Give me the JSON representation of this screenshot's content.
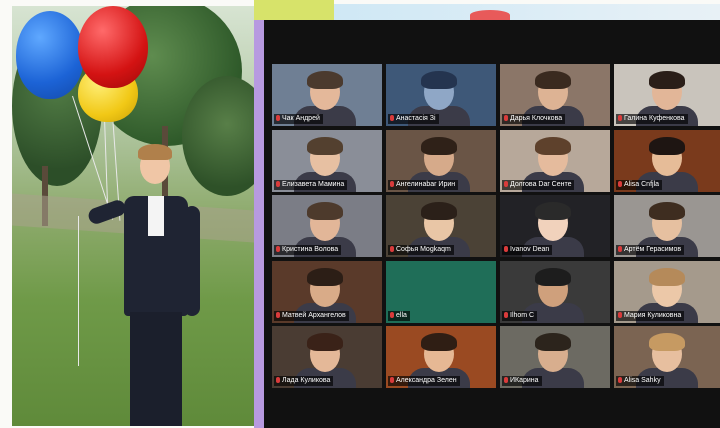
{
  "zoom": {
    "participants": [
      {
        "name": "Чак Андрей",
        "bg": "#6f7f94",
        "skin": "#e4b89a",
        "hair": "#4b3a2e"
      },
      {
        "name": "Анастасія Зі",
        "bg": "#3e5878",
        "skin": "#8fa7c6",
        "hair": "#24344f"
      },
      {
        "name": "Дарья Клочкова",
        "bg": "#8b7668",
        "skin": "#ddb394",
        "hair": "#3a2a1f"
      },
      {
        "name": "Галина Куфенкова",
        "bg": "#c9c4bc",
        "skin": "#e2b698",
        "hair": "#2a1e18"
      },
      {
        "name": "Елизавета Мамина",
        "bg": "#8a8e98",
        "skin": "#e7c0a2",
        "hair": "#53402f"
      },
      {
        "name": "Ангелинаbar Ирин",
        "bg": "#6a5546",
        "skin": "#d6aa8a",
        "hair": "#2f2118"
      },
      {
        "name": "Долгова Dar Сенте",
        "bg": "#b7a89a",
        "skin": "#e5bb9d",
        "hair": "#5e412c"
      },
      {
        "name": "Alisa Cnfjla",
        "bg": "#7a3a1c",
        "skin": "#e6bc98",
        "hair": "#1e1512"
      },
      {
        "name": "Кристина Волова",
        "bg": "#7b7d86",
        "skin": "#e2b698",
        "hair": "#4d3a2c"
      },
      {
        "name": "Софья Mogkaqm",
        "bg": "#4b4236",
        "skin": "#e9c6a6",
        "hair": "#2b2019"
      },
      {
        "name": "Ivanov Dean",
        "bg": "#222226",
        "skin": "#f1d2bc",
        "hair": "#2a2a2a"
      },
      {
        "name": "Артём Герасимов",
        "bg": "#9a9692",
        "skin": "#e6c0a0",
        "hair": "#3e2d20"
      },
      {
        "name": "Матвей Архангелов",
        "bg": "#5a3a2a",
        "skin": "#d9ab88",
        "hair": "#2c1e16"
      },
      {
        "name": "ella",
        "bg": "#1f6e58",
        "skin": "",
        "hair": ""
      },
      {
        "name": "Ilhom C",
        "bg": "#3a3a3a",
        "skin": "#cfa07c",
        "hair": "#1d1d1d"
      },
      {
        "name": "Мария Куликовна",
        "bg": "#a59a8c",
        "skin": "#ecc8a8",
        "hair": "#b58a5a"
      },
      {
        "name": "Лада Куликова",
        "bg": "#4a3c33",
        "skin": "#e4b898",
        "hair": "#3a2218"
      },
      {
        "name": "Александра Зелен",
        "bg": "#9a4a22",
        "skin": "#e6b894",
        "hair": "#2f1e14"
      },
      {
        "name": "ИКарина",
        "bg": "#6c6a62",
        "skin": "#d8ae8e",
        "hair": "#2c241c"
      },
      {
        "name": "Alisa Sahky",
        "bg": "#7b6452",
        "skin": "#e7bf9f",
        "hair": "#c69a62"
      }
    ]
  }
}
